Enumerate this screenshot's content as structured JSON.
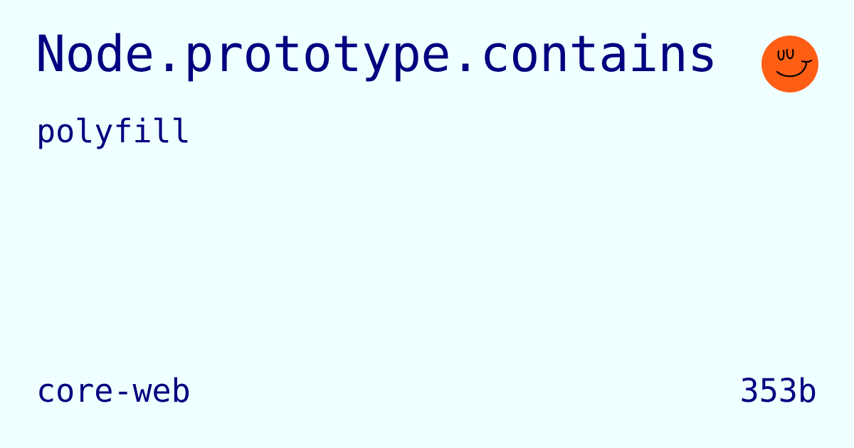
{
  "colors": {
    "background": "#F0FFFF",
    "text": "#000080",
    "logo_fill": "#FF5E14",
    "logo_stroke": "#000000"
  },
  "card": {
    "title": "Node.prototype.contains",
    "subtitle": "polyfill",
    "collection": "core-web",
    "size": "353b",
    "logo_icon": "smiley-face-icon"
  }
}
